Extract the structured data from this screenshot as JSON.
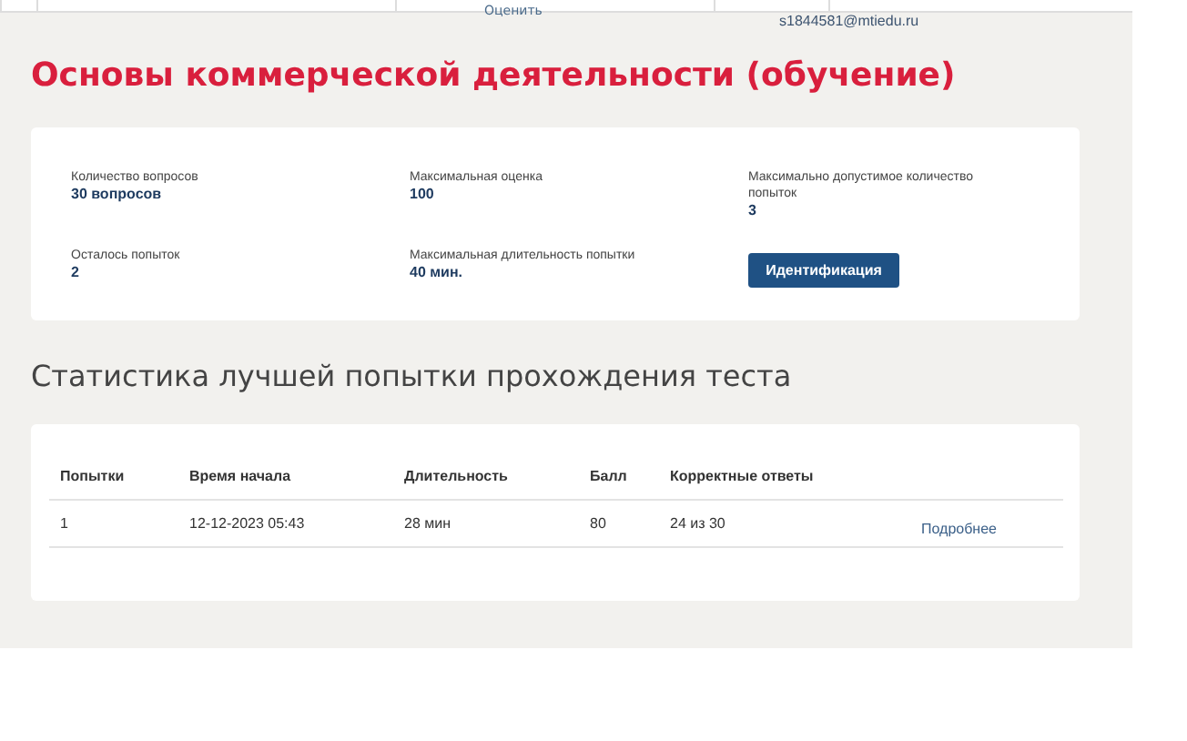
{
  "top_strip": {
    "rate_label": "Оценить",
    "email": "s1844581@mtiedu.ru"
  },
  "title": "Основы коммерческой деятельности (обучение)",
  "info": [
    {
      "label": "Количество вопросов",
      "value": "30 вопросов"
    },
    {
      "label": "Максимальная оценка",
      "value": "100"
    },
    {
      "label": "Максимально допустимое количество попыток",
      "value": "3"
    },
    {
      "label": "Осталось попыток",
      "value": "2"
    },
    {
      "label": "Максимальная длительность попытки",
      "value": "40 мин."
    }
  ],
  "identify_button": "Идентификация",
  "stats_heading": "Статистика лучшей попытки прохождения теста",
  "table": {
    "columns": [
      "Попытки",
      "Время начала",
      "Длительность",
      "Балл",
      "Корректные ответы"
    ],
    "rows": [
      {
        "cells": [
          "1",
          "12-12-2023 05:43",
          "28 мин",
          "80",
          "24 из 30"
        ],
        "link": "Подробнее"
      }
    ]
  }
}
